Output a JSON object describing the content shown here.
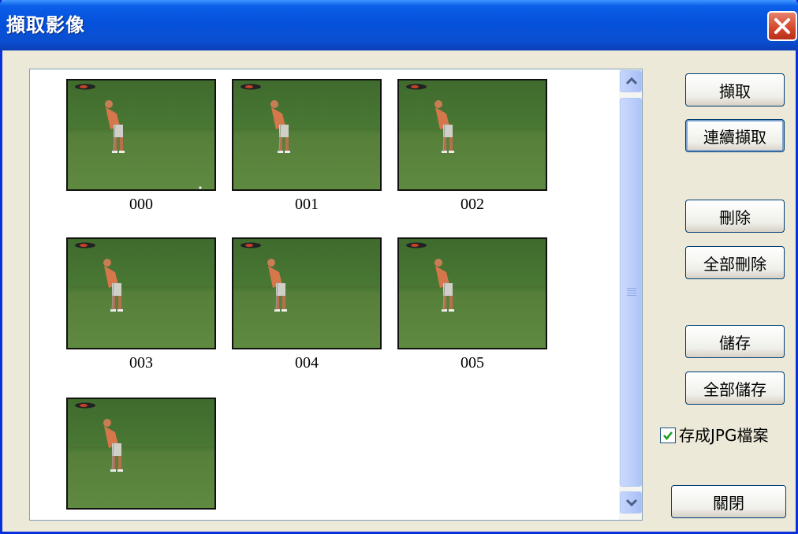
{
  "window": {
    "title": "擷取影像",
    "close_icon": "close-icon"
  },
  "thumbnails": [
    {
      "label": "000"
    },
    {
      "label": "001"
    },
    {
      "label": "002"
    },
    {
      "label": "003"
    },
    {
      "label": "004"
    },
    {
      "label": "005"
    },
    {
      "label": ""
    }
  ],
  "buttons": {
    "capture": "擷取",
    "continuous_capture": "連續擷取",
    "delete": "刪除",
    "delete_all": "全部刪除",
    "save": "儲存",
    "save_all": "全部儲存",
    "close": "關閉"
  },
  "save_as_jpg": {
    "label": "存成JPG檔案",
    "checked": true
  },
  "scrollbar": {
    "up_icon": "chevron-up-icon",
    "down_icon": "chevron-down-icon"
  },
  "colors": {
    "titlebar": "#0551dc",
    "close": "#d4452a",
    "grass": "#4f7a36",
    "check": "#21a121"
  }
}
